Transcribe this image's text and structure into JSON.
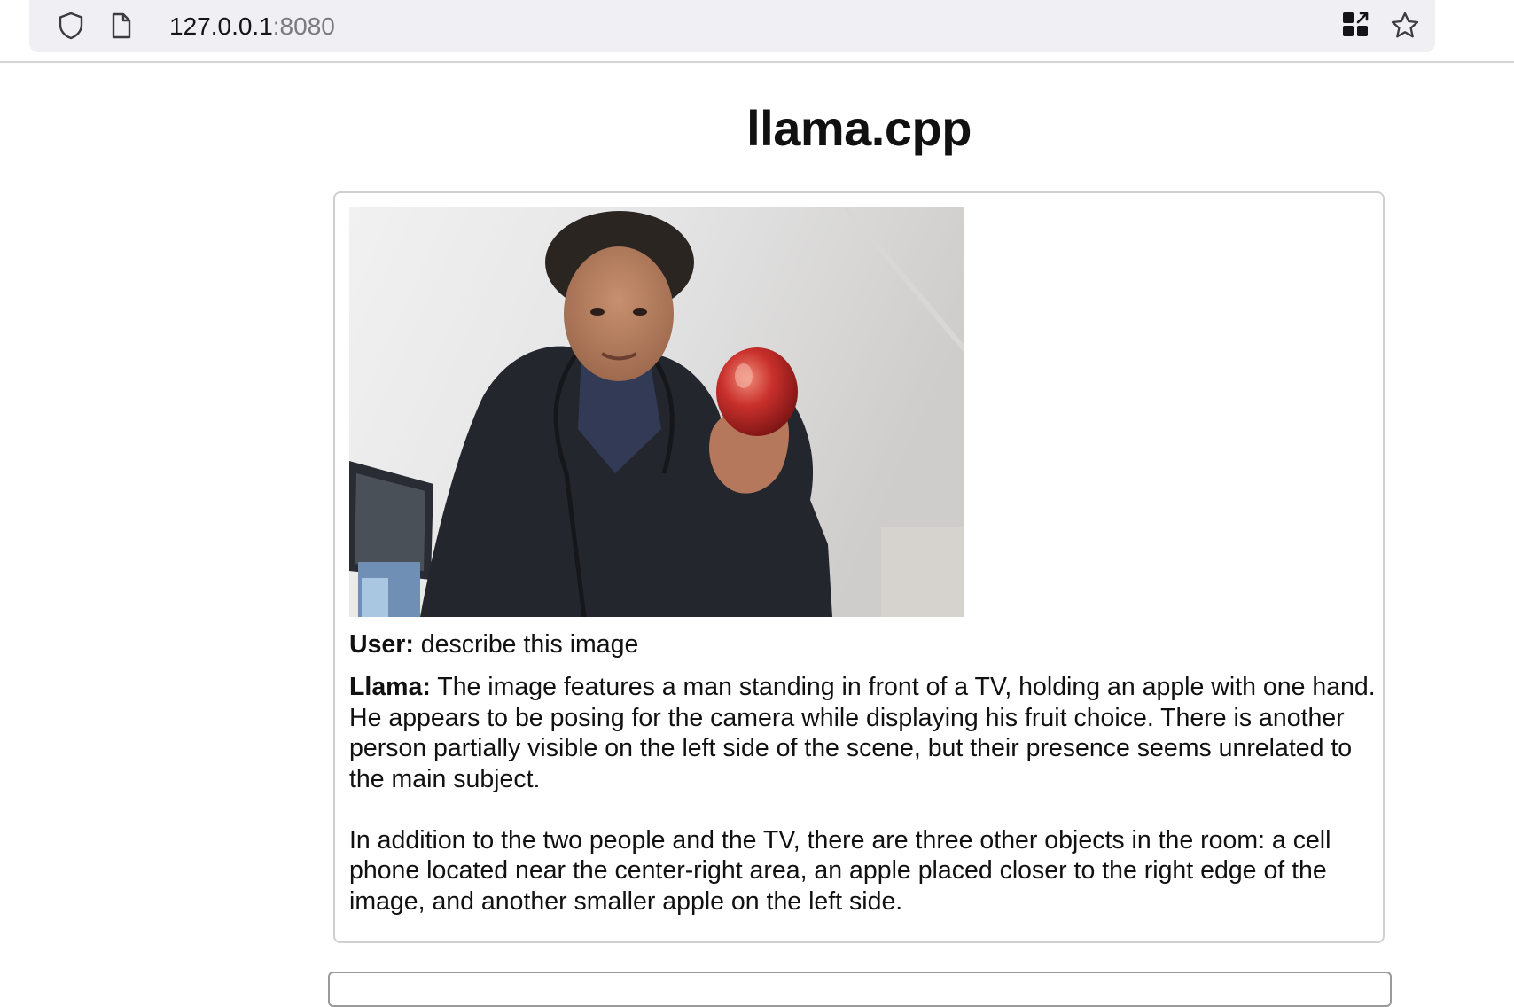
{
  "browser": {
    "url_host": "127.0.0.1",
    "url_port": ":8080",
    "icons": [
      "shield-icon",
      "page-icon",
      "extensions-grid-icon",
      "bookmark-star-icon"
    ]
  },
  "page": {
    "title": "llama.cpp"
  },
  "chat": {
    "messages": [
      {
        "role_label": "User:",
        "text": "describe this image"
      },
      {
        "role_label": "Llama:",
        "text_1": "The image features a man standing in front of a TV, holding an apple with one hand. He appears to be posing for the camera while displaying his fruit choice. There is another person partially visible on the left side of the scene, but their presence seems unrelated to the main subject.",
        "text_2": "In addition to the two people and the TV, there are three other objects in the room: a cell phone located near the center-right area, an apple placed closer to the right edge of the image, and another smaller apple on the left side."
      }
    ]
  },
  "colors": {
    "url_bar_bg": "#f0f0f4",
    "box_border": "#d0d0d0",
    "apple_red": "#c9302c"
  }
}
